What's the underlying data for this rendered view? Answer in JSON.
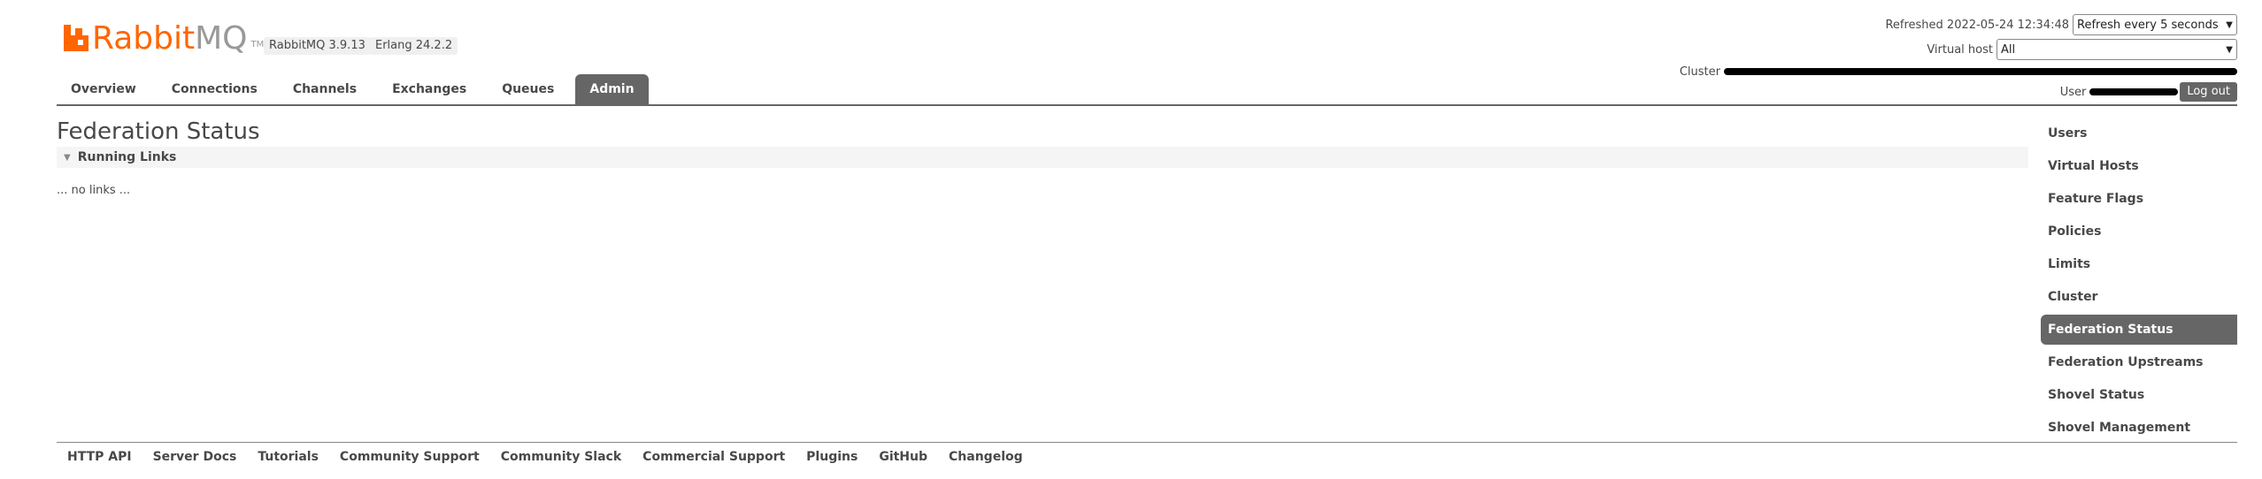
{
  "header": {
    "logo_rabbit": "Rabbit",
    "logo_mq": "MQ",
    "logo_tm": "TM",
    "rabbitmq_version": "RabbitMQ 3.9.13",
    "erlang_version": "Erlang 24.2.2",
    "refreshed_label": "Refreshed 2022-05-24 12:34:48",
    "refresh_select": "Refresh every 5 seconds",
    "vhost_label": "Virtual host",
    "vhost_select": "All",
    "cluster_label": "Cluster",
    "user_label": "User",
    "logout_label": "Log out"
  },
  "tabs": [
    {
      "label": "Overview"
    },
    {
      "label": "Connections"
    },
    {
      "label": "Channels"
    },
    {
      "label": "Exchanges"
    },
    {
      "label": "Queues"
    },
    {
      "label": "Admin"
    }
  ],
  "main": {
    "title": "Federation Status",
    "section_title": "Running Links",
    "empty_text": "... no links ..."
  },
  "sidebar": [
    {
      "label": "Users"
    },
    {
      "label": "Virtual Hosts"
    },
    {
      "label": "Feature Flags"
    },
    {
      "label": "Policies"
    },
    {
      "label": "Limits"
    },
    {
      "label": "Cluster"
    },
    {
      "label": "Federation Status"
    },
    {
      "label": "Federation Upstreams"
    },
    {
      "label": "Shovel Status"
    },
    {
      "label": "Shovel Management"
    }
  ],
  "footer": [
    {
      "label": "HTTP API"
    },
    {
      "label": "Server Docs"
    },
    {
      "label": "Tutorials"
    },
    {
      "label": "Community Support"
    },
    {
      "label": "Community Slack"
    },
    {
      "label": "Commercial Support"
    },
    {
      "label": "Plugins"
    },
    {
      "label": "GitHub"
    },
    {
      "label": "Changelog"
    }
  ],
  "colors": {
    "brand_orange": "#ff6600",
    "active_tab": "#666666",
    "text": "#484848"
  }
}
